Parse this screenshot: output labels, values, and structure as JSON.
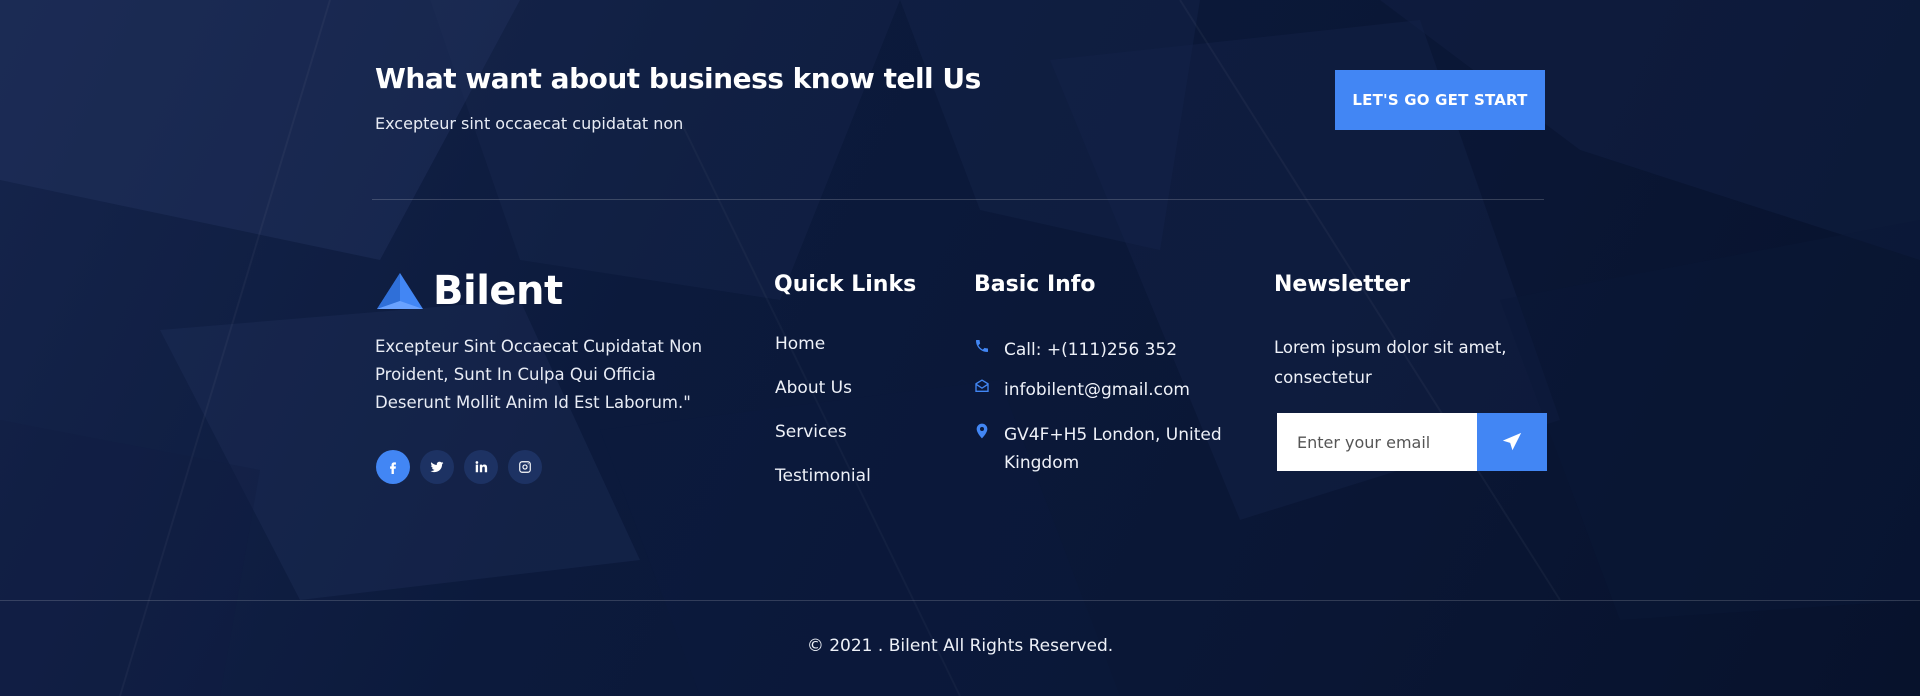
{
  "cta": {
    "title": "What want about business know tell Us",
    "subtitle": "Excepteur sint occaecat cupidatat non",
    "button_label": "LET'S GO GET START"
  },
  "brand": {
    "name": "Bilent",
    "description": "Excepteur Sint Occaecat Cupidatat Non Proident, Sunt In Culpa Qui Officia Deserunt Mollit Anim Id Est Laborum.\"",
    "socials": [
      {
        "icon": "facebook-icon",
        "active": true
      },
      {
        "icon": "twitter-icon",
        "active": false
      },
      {
        "icon": "linkedin-icon",
        "active": false
      },
      {
        "icon": "instagram-icon",
        "active": false
      }
    ]
  },
  "quick_links": {
    "title": "Quick Links",
    "items": [
      "Home",
      "About Us",
      "Services",
      "Testimonial"
    ]
  },
  "basic_info": {
    "title": "Basic Info",
    "phone": "Call: +(111)256 352",
    "email": "infobilent@gmail.com",
    "address": "GV4F+H5 London, United Kingdom"
  },
  "newsletter": {
    "title": "Newsletter",
    "text": "Lorem ipsum dolor sit amet, consectetur",
    "placeholder": "Enter your email"
  },
  "copyright": "© 2021 . Bilent All Rights Reserved.",
  "colors": {
    "accent": "#4286f4",
    "background": "#0b1a3c",
    "social_bg": "#1d3263"
  }
}
